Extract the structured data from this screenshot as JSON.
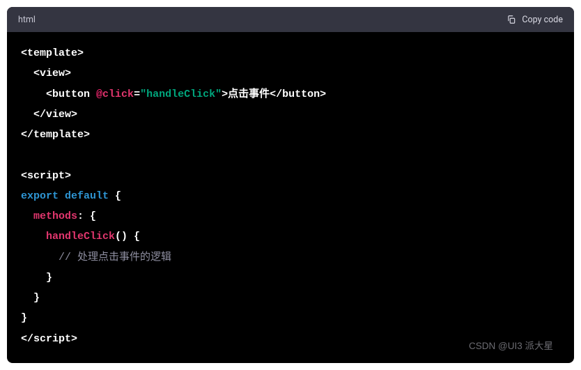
{
  "header": {
    "language": "html",
    "copy_label": "Copy code"
  },
  "code": {
    "lines": [
      [
        {
          "t": "<template>",
          "c": "tok-white"
        }
      ],
      [
        {
          "t": "  ",
          "c": "tok-white"
        },
        {
          "t": "<view>",
          "c": "tok-white"
        }
      ],
      [
        {
          "t": "    ",
          "c": "tok-white"
        },
        {
          "t": "<button ",
          "c": "tok-white"
        },
        {
          "t": "@",
          "c": "tok-pink"
        },
        {
          "t": "click",
          "c": "tok-red"
        },
        {
          "t": "=",
          "c": "tok-white"
        },
        {
          "t": "\"handleClick\"",
          "c": "tok-green"
        },
        {
          "t": ">点击事件</button>",
          "c": "tok-white"
        }
      ],
      [
        {
          "t": "  ",
          "c": "tok-white"
        },
        {
          "t": "</view>",
          "c": "tok-white"
        }
      ],
      [
        {
          "t": "</template>",
          "c": "tok-white"
        }
      ],
      [
        {
          "t": "",
          "c": "tok-white"
        }
      ],
      [
        {
          "t": "<script>",
          "c": "tok-white"
        }
      ],
      [
        {
          "t": "export default",
          "c": "tok-blue"
        },
        {
          "t": " {",
          "c": "tok-white"
        }
      ],
      [
        {
          "t": "  ",
          "c": "tok-white"
        },
        {
          "t": "methods",
          "c": "tok-red"
        },
        {
          "t": ": {",
          "c": "tok-white"
        }
      ],
      [
        {
          "t": "    ",
          "c": "tok-white"
        },
        {
          "t": "handleClick",
          "c": "tok-red"
        },
        {
          "t": "() {",
          "c": "tok-white"
        }
      ],
      [
        {
          "t": "      ",
          "c": "tok-white"
        },
        {
          "t": "// 处理点击事件的逻辑",
          "c": "tok-comment"
        }
      ],
      [
        {
          "t": "    }",
          "c": "tok-white"
        }
      ],
      [
        {
          "t": "  }",
          "c": "tok-white"
        }
      ],
      [
        {
          "t": "}",
          "c": "tok-white"
        }
      ],
      [
        {
          "t": "</script>",
          "c": "tok-white"
        }
      ]
    ]
  },
  "watermark": "CSDN @UI3 派大星"
}
